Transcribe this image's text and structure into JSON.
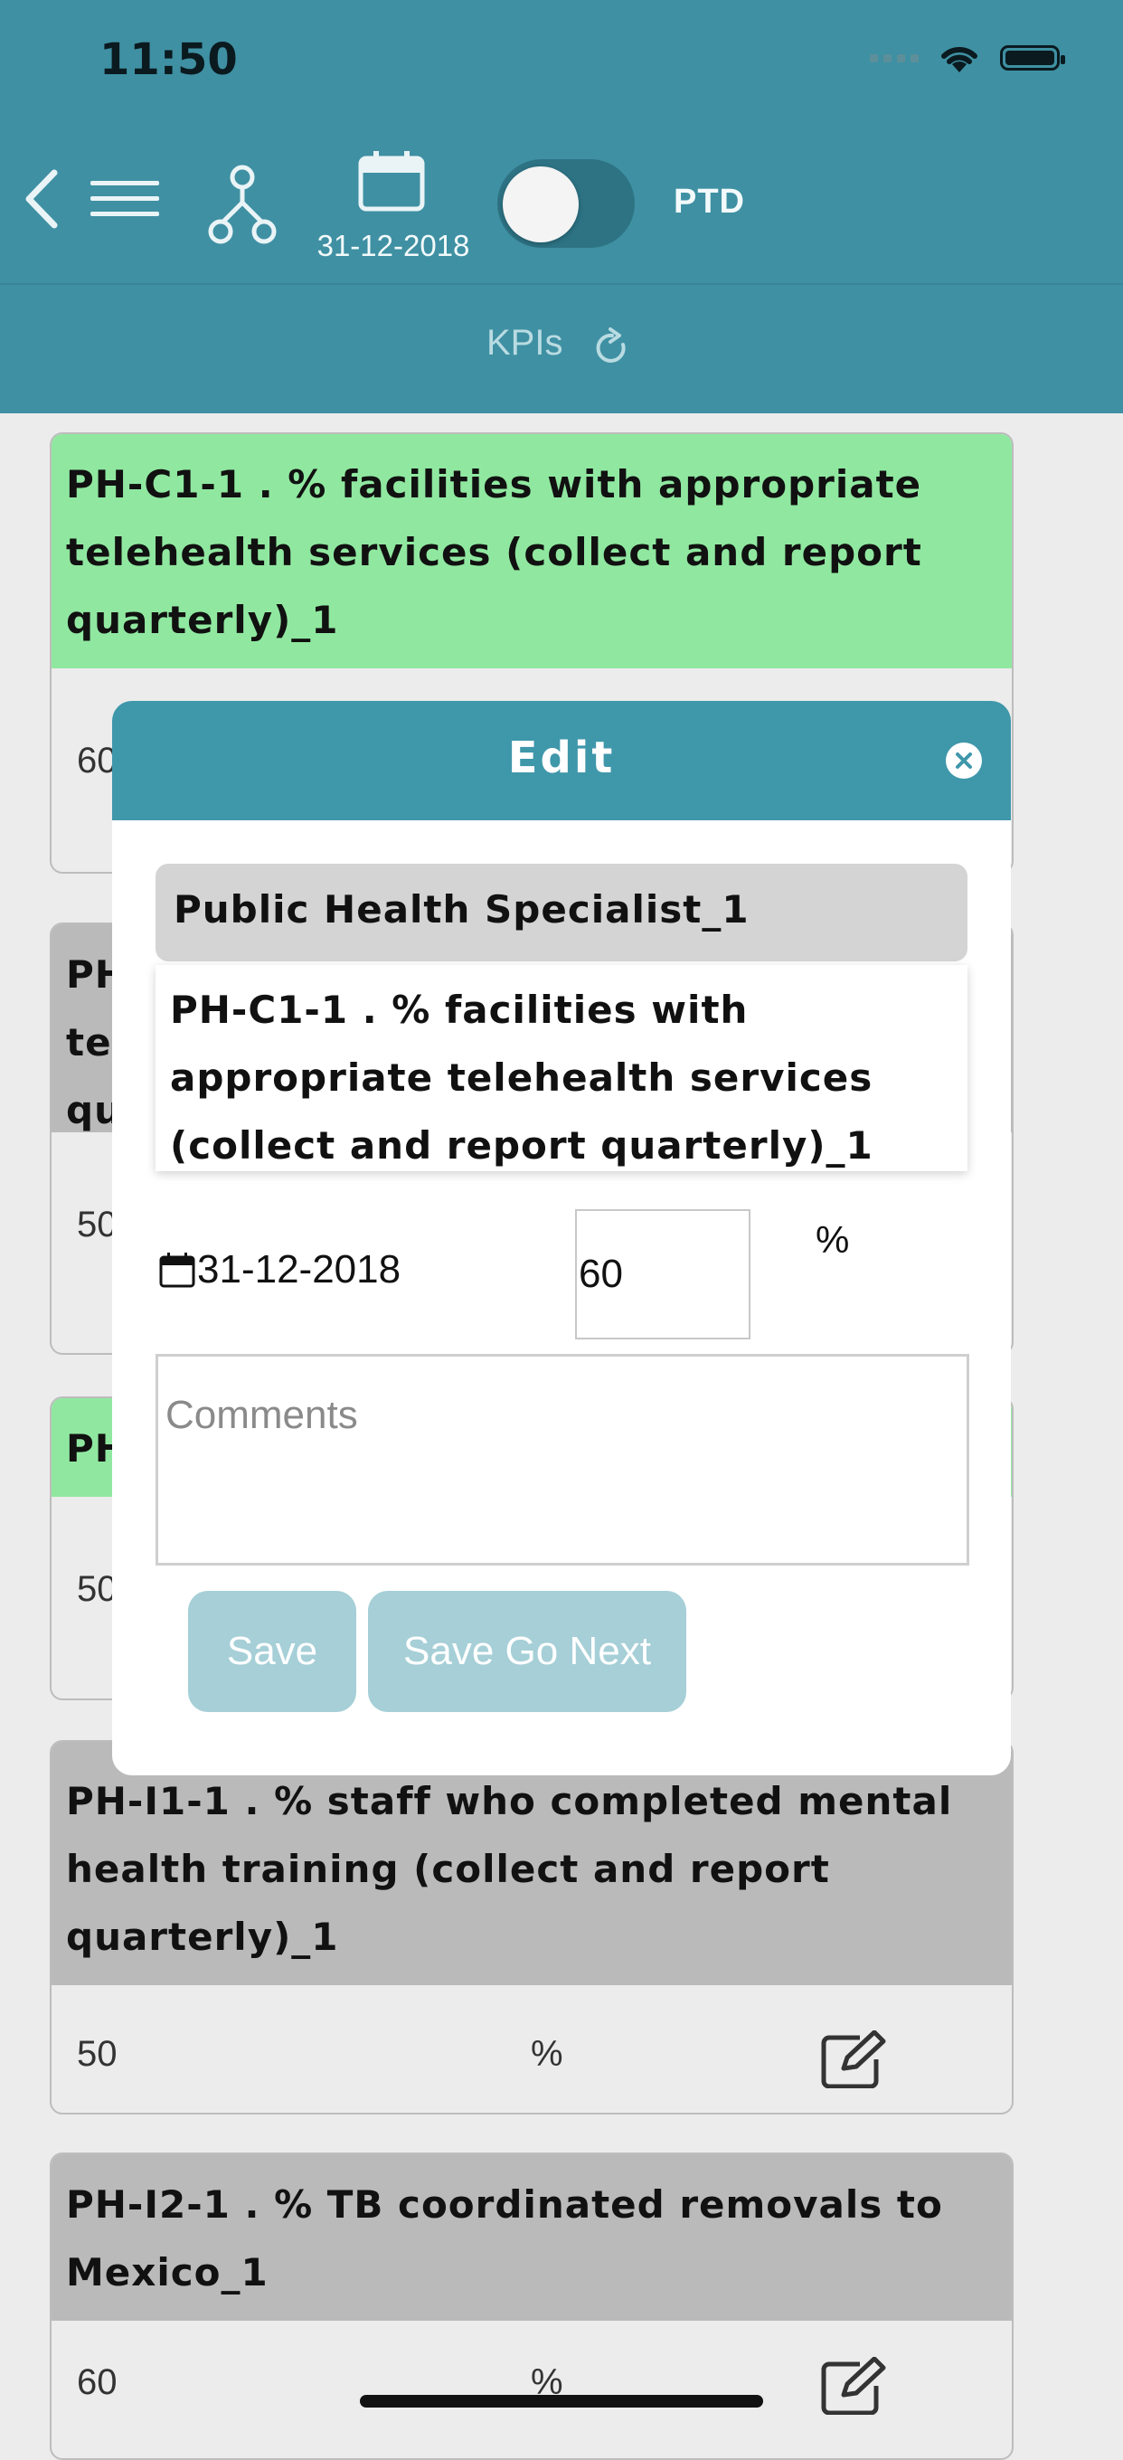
{
  "status_bar": {
    "time": "11:50"
  },
  "header": {
    "date": "31-12-2018",
    "mode_label": "PTD",
    "toggle_on": false
  },
  "subheader": {
    "title": "KPIs"
  },
  "cards": [
    {
      "title": "PH-C1-1 . % facilities with appropriate telehealth services (collect and report quarterly)_1",
      "value": "60",
      "unit": "%",
      "color": "#90e8a0"
    },
    {
      "title": "PH",
      "title_fragment_lines": [
        "PH",
        "tel",
        "qu"
      ],
      "value": "50",
      "color": "#bababa"
    },
    {
      "title": "PH",
      "value": "50",
      "color": "#90e8a0"
    },
    {
      "title": "PH-I1-1 . % staff who completed mental health training (collect and report quarterly)_1",
      "value": "50",
      "unit": "%",
      "color": "#bababa"
    },
    {
      "title": "PH-I2-1 . % TB coordinated removals to Mexico_1",
      "value": "60",
      "unit": "%",
      "color": "#bababa"
    }
  ],
  "modal": {
    "title": "Edit",
    "role": "Public Health Specialist_1",
    "kpi": "PH-C1-1 . % facilities with appropriate telehealth services (collect and report quarterly)_1",
    "date": "31-12-2018",
    "value": "60",
    "unit": "%",
    "comments_placeholder": "Comments",
    "save_label": "Save",
    "save_next_label": "Save Go Next"
  },
  "colors": {
    "header_bg": "#3f90a3",
    "modal_header_bg": "#3f97aa",
    "button_bg": "#a6cfd7",
    "card_green": "#90e8a0",
    "card_grey": "#bababa"
  }
}
